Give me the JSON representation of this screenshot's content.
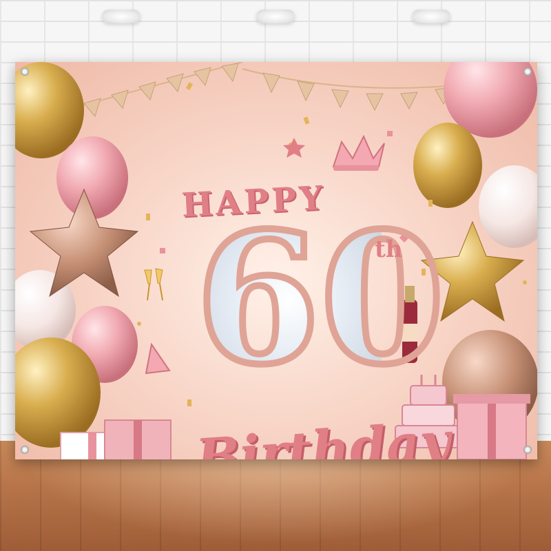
{
  "banner": {
    "line1": "HAPPY",
    "number": "60",
    "suffix": "th",
    "line2": "Birthday"
  },
  "colors": {
    "rose_gold": "#e07f86",
    "blush": "#f8d6c8",
    "gold": "#d9ae4f",
    "pink_balloon": "#f1a9b1",
    "wood": "#b8754a"
  }
}
